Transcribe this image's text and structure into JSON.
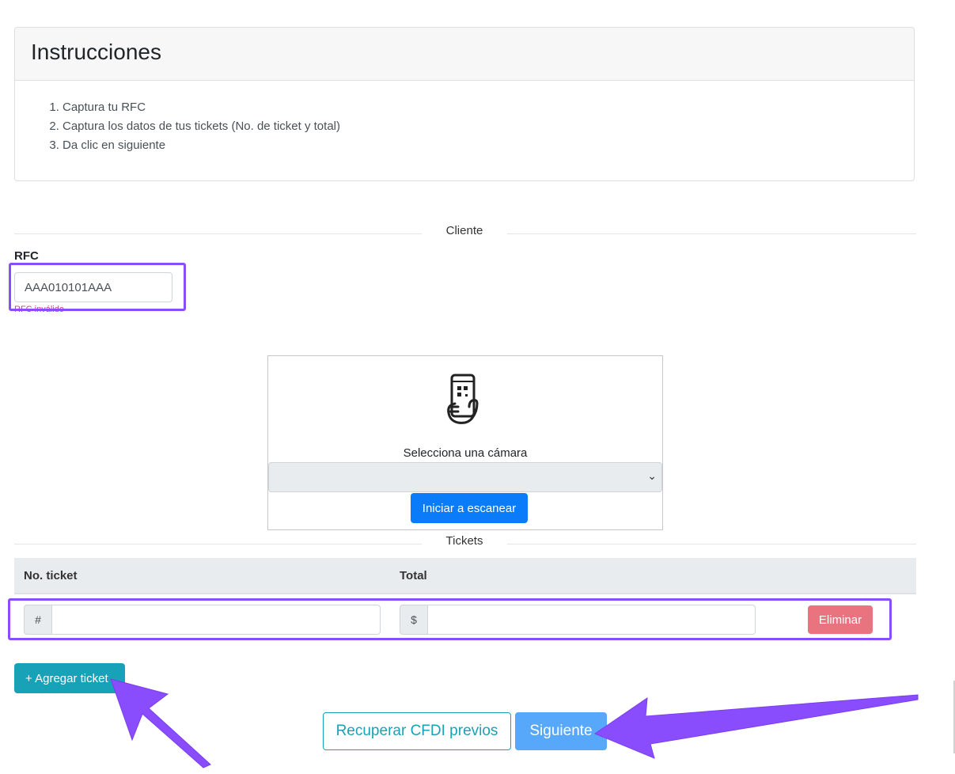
{
  "instructions": {
    "title": "Instrucciones",
    "steps": [
      "Captura tu RFC",
      "Captura los datos de tus tickets (No. de ticket y total)",
      "Da clic en siguiente"
    ]
  },
  "cliente": {
    "section_label": "Cliente",
    "rfc_label": "RFC",
    "rfc_value": "AAA010101AAA",
    "rfc_error": "RFC inválido"
  },
  "scanner": {
    "icon": "phone-qr-scan-icon",
    "camera_label": "Selecciona una cámara",
    "camera_selected": "",
    "start_label": "Iniciar a escanear"
  },
  "tickets": {
    "section_label": "Tickets",
    "columns": [
      "No. ticket",
      "Total"
    ],
    "rows": [
      {
        "ticket_prefix": "#",
        "ticket_value": "",
        "total_prefix": "$",
        "total_value": "",
        "delete_label": "Eliminar"
      }
    ],
    "add_label": "+ Agregar ticket"
  },
  "actions": {
    "recover_label": "Recuperar CFDI previos",
    "next_label": "Siguiente"
  },
  "colors": {
    "annotation": "#8a4dfd",
    "primary": "#0a7cf9",
    "info": "#17a2b8",
    "danger": "#e9747f"
  }
}
